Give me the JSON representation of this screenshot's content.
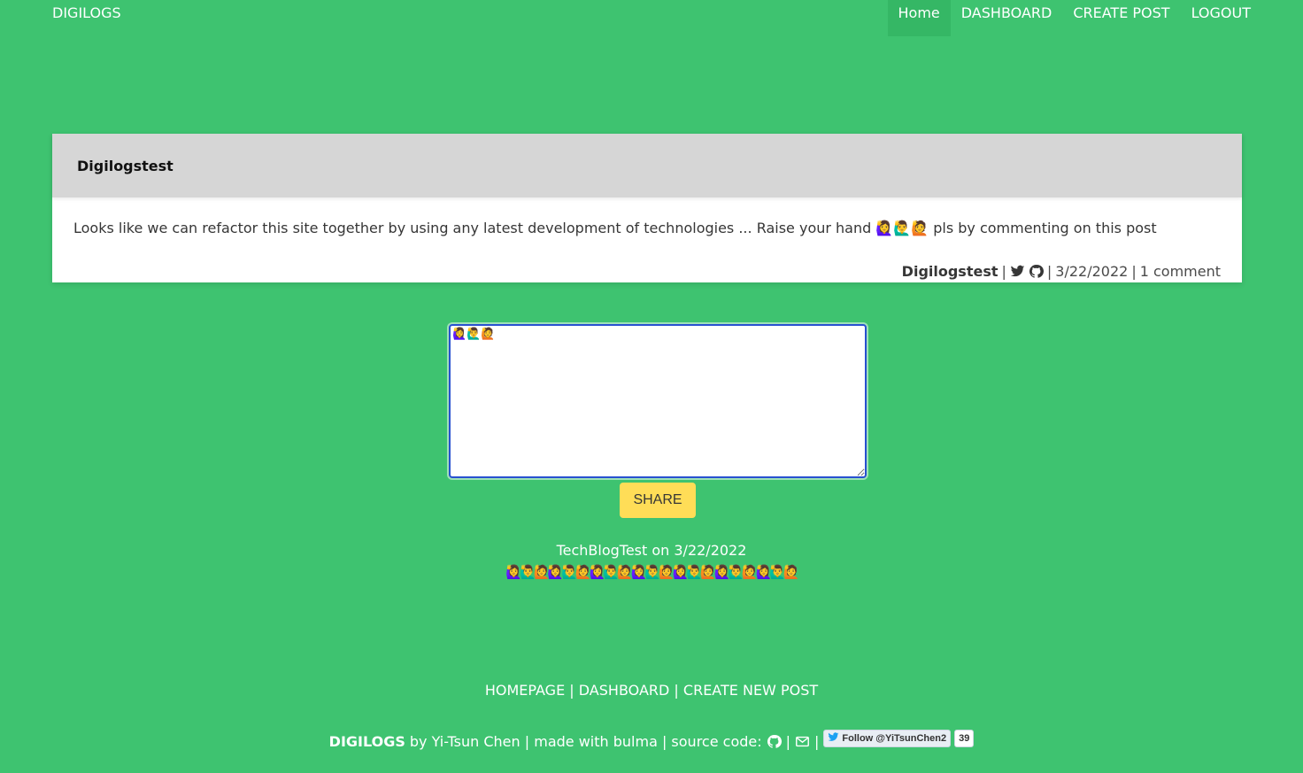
{
  "nav": {
    "brand": "DIGILOGS",
    "items": [
      {
        "label": "Home",
        "active": true
      },
      {
        "label": "DASHBOARD"
      },
      {
        "label": "CREATE POST"
      },
      {
        "label": "LOGOUT"
      }
    ]
  },
  "post": {
    "title": "Digilogstest",
    "body": "Looks like we can refactor this site together by using any latest development of technologies ... Raise your hand 🙋‍♀️🙋‍♂️🙋 pls by commenting on this post",
    "author": "Digilogstest",
    "sep": "|",
    "twitter_icon": "twitter-icon",
    "github_icon": "github-icon",
    "date": "3/22/2022",
    "comments": "1 comment"
  },
  "comment_form": {
    "value": "🙋‍♀️🙋‍♂️🙋",
    "button": "SHARE"
  },
  "comments": [
    {
      "meta": "TechBlogTest on 3/22/2022",
      "text": "🙋‍♀️🙋‍♂️🙋🙋‍♀️🙋‍♂️🙋🙋‍♀️🙋‍♂️🙋🙋‍♀️🙋‍♂️🙋🙋‍♀️🙋‍♂️🙋🙋‍♀️🙋‍♂️🙋🙋‍♀️🙋‍♂️🙋"
    }
  ],
  "footer": {
    "links": [
      "HOMEPAGE",
      "DASHBOARD",
      "CREATE NEW POST"
    ],
    "sep": "|",
    "brand": "DIGILOGS",
    "credit": "by Yi-Tsun Chen | made with bulma | source code:",
    "follow_label": "Follow @YiTsunChen2",
    "follow_count": "39"
  },
  "colors": {
    "background": "#3ec370",
    "accent": "#ffdd57",
    "focus": "#2851d0"
  }
}
